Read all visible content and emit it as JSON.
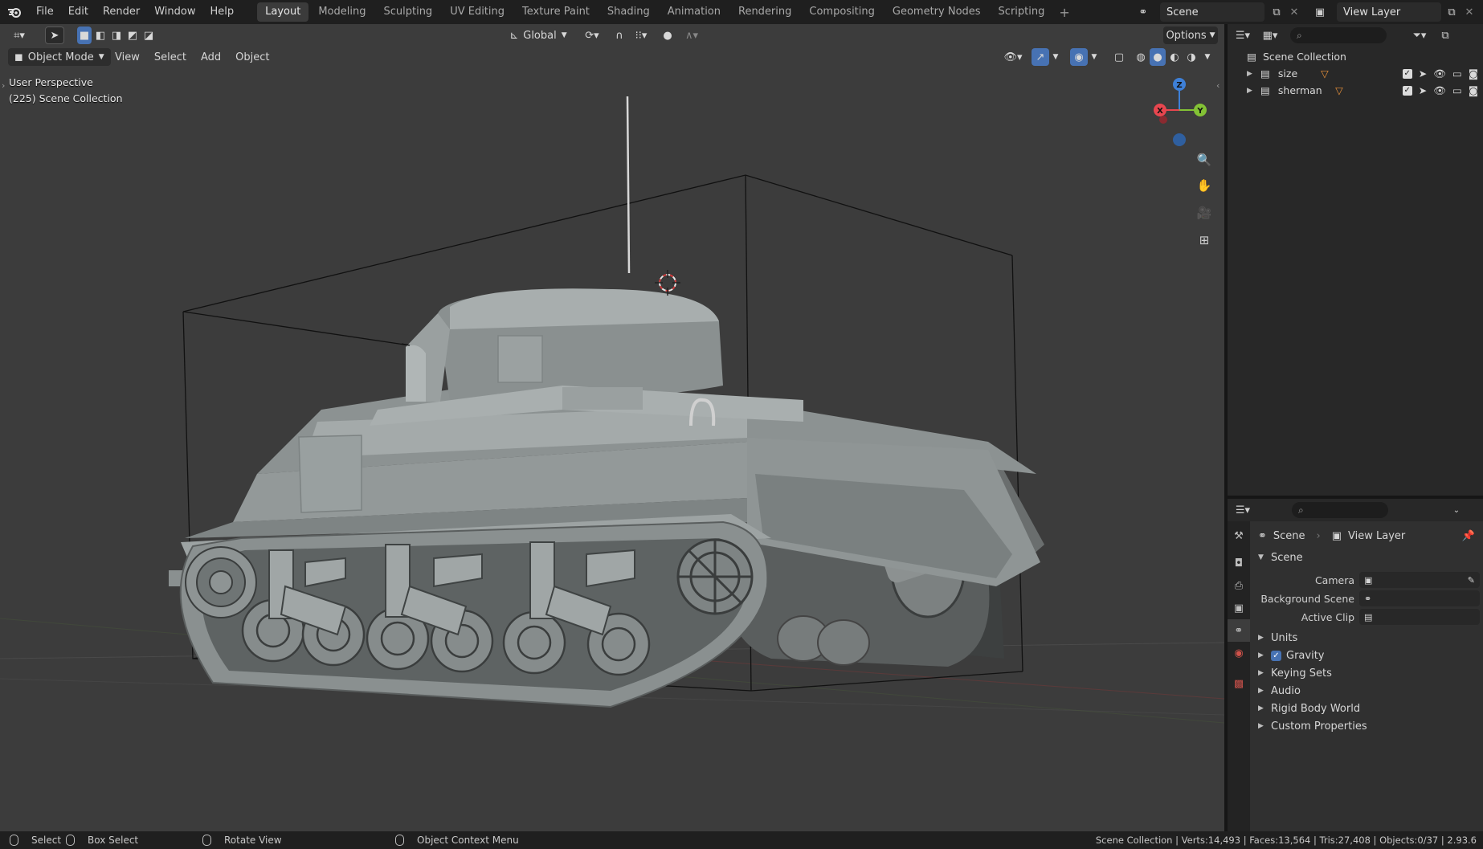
{
  "topbar": {
    "menu": [
      "File",
      "Edit",
      "Render",
      "Window",
      "Help"
    ],
    "workspaces": [
      "Layout",
      "Modeling",
      "Sculpting",
      "UV Editing",
      "Texture Paint",
      "Shading",
      "Animation",
      "Rendering",
      "Compositing",
      "Geometry Nodes",
      "Scripting"
    ],
    "active_workspace": "Layout",
    "scene": "Scene",
    "view_layer": "View Layer"
  },
  "viewport": {
    "transform_orientation": "Global",
    "options_label": "Options",
    "mode": "Object Mode",
    "menus": [
      "View",
      "Select",
      "Add",
      "Object"
    ],
    "perspective_label": "User Perspective",
    "collection_label": "(225) Scene Collection",
    "gizmo_axes": [
      "X",
      "Y",
      "Z"
    ]
  },
  "outliner": {
    "root": "Scene Collection",
    "items": [
      {
        "name": "size"
      },
      {
        "name": "sherman"
      }
    ]
  },
  "properties": {
    "breadcrumb_scene": "Scene",
    "breadcrumb_view_layer": "View Layer",
    "panel_title": "Scene",
    "fields": [
      {
        "label": "Camera",
        "value": ""
      },
      {
        "label": "Background Scene",
        "value": ""
      },
      {
        "label": "Active Clip",
        "value": ""
      }
    ],
    "subpanels": [
      {
        "label": "Units",
        "checkbox": false
      },
      {
        "label": "Gravity",
        "checkbox": true
      },
      {
        "label": "Keying Sets",
        "checkbox": false
      },
      {
        "label": "Audio",
        "checkbox": false
      },
      {
        "label": "Rigid Body World",
        "checkbox": false
      },
      {
        "label": "Custom Properties",
        "checkbox": false
      }
    ]
  },
  "statusbar": {
    "select": "Select",
    "box_select": "Box Select",
    "rotate_view": "Rotate View",
    "context_menu": "Object Context Menu",
    "stats": "Scene Collection | Verts:14,493 | Faces:13,564 | Tris:27,408 | Objects:0/37 | 2.93.6"
  },
  "colors": {
    "accent": "#4772b3",
    "viewport_bg": "#3c3c3c",
    "axis_x": "#e8464f",
    "axis_y": "#83c235",
    "axis_z": "#3e80d8",
    "object_orange": "#e8913a"
  }
}
